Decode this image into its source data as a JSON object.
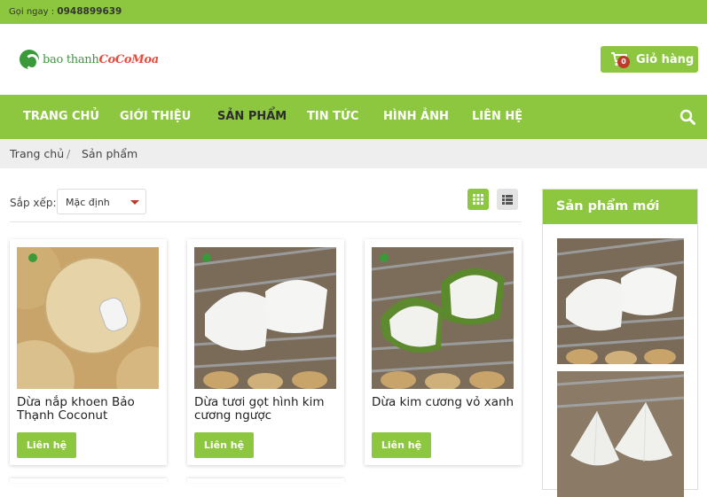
{
  "topbar": {
    "call_label": "Gọi ngay :",
    "phone": "0948899639"
  },
  "header": {
    "logo_text_a": "bao thanh",
    "logo_text_b": "CoCoMoa",
    "cart": {
      "label": "Giỏ hàng",
      "count": "0"
    }
  },
  "nav": {
    "items": [
      {
        "label": "TRANG CHỦ"
      },
      {
        "label": "GIỚI THIỆU"
      },
      {
        "label": "SẢN PHẨM"
      },
      {
        "label": "TIN TỨC"
      },
      {
        "label": "HÌNH ẢNH"
      },
      {
        "label": "LIÊN HỆ"
      }
    ],
    "active": "SẢN PHẨM"
  },
  "breadcrumb": {
    "home": "Trang chủ",
    "separator": "/",
    "current": "Sản phẩm"
  },
  "toolbar": {
    "sort_label": "Sắp xếp:",
    "sort_value": "Mặc định"
  },
  "products": [
    {
      "title": "Dừa nắp khoen Bảo Thạnh Coconut",
      "button": "Liên hệ"
    },
    {
      "title": "Dừa tươi gọt hình kim cương ngược",
      "button": "Liên hệ"
    },
    {
      "title": "Dừa kim cương vỏ xanh",
      "button": "Liên hệ"
    }
  ],
  "sidebar": {
    "title": "Sản phẩm mới"
  },
  "colors": {
    "accent": "#8dc63f",
    "badge": "#c0392b"
  }
}
